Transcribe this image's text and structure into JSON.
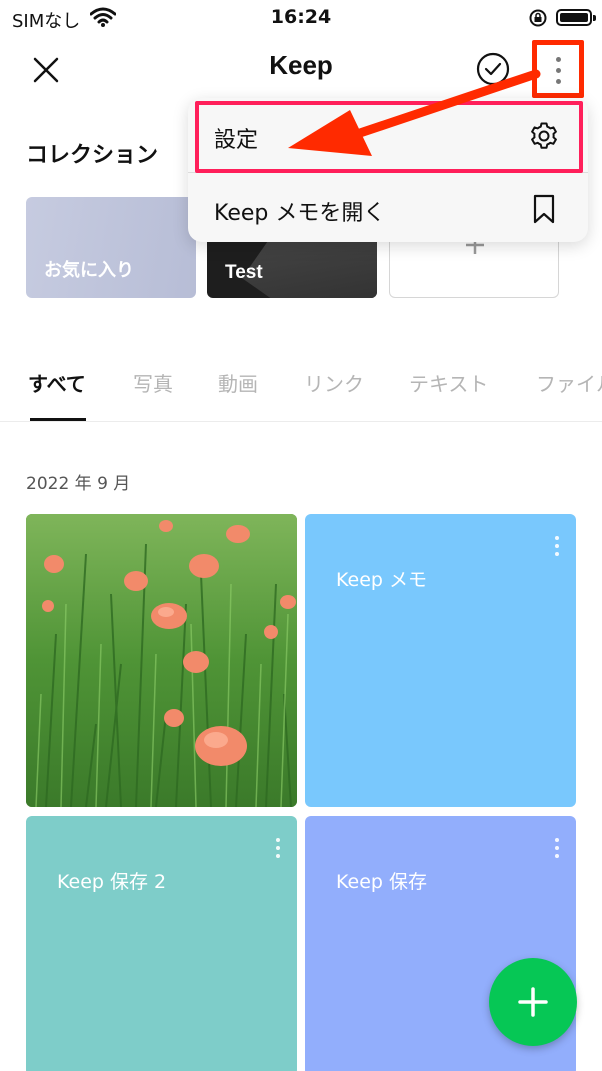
{
  "status_bar": {
    "carrier": "SIMなし",
    "time": "16:24"
  },
  "header": {
    "title": "Keep"
  },
  "collections": {
    "title": "コレクション",
    "items": [
      {
        "label": "お気に入り"
      },
      {
        "label": "Test"
      }
    ]
  },
  "tabs": [
    "すべて",
    "写真",
    "動画",
    "リンク",
    "テキスト",
    "ファイル"
  ],
  "date_group": "2022 年 9 月",
  "tiles": [
    {
      "label": "Keep メモ",
      "color": "#79c8fd"
    },
    {
      "label": "Keep 保存 2",
      "color": "#7ecdc9"
    },
    {
      "label": "Keep 保存",
      "color": "#92aefc"
    }
  ],
  "menu": {
    "items": [
      {
        "label": "設定",
        "icon": "gear-icon"
      },
      {
        "label": "Keep メモを開く",
        "icon": "bookmark-icon"
      }
    ]
  },
  "colors": {
    "fab": "#06c755",
    "highlight_border": "#ff1f5a",
    "annotation_arrow": "#ff2a00"
  }
}
